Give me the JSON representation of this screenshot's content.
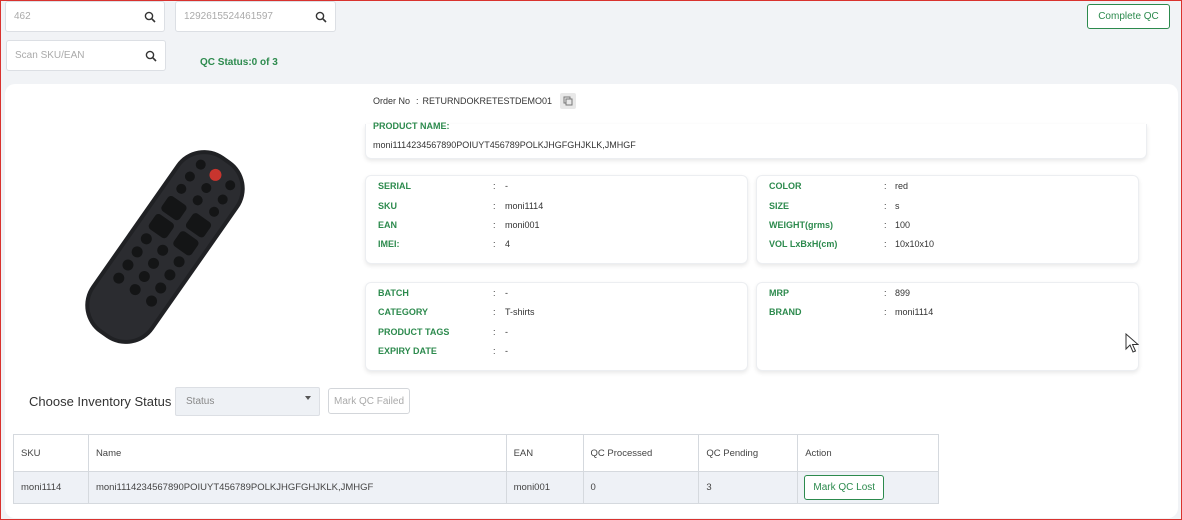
{
  "search": {
    "field1_value": "462",
    "field2_value": "1292615524461597",
    "scan_placeholder": "Scan SKU/EAN"
  },
  "toolbar": {
    "complete_qc_label": "Complete QC",
    "qc_status": "QC Status:0 of 3"
  },
  "order": {
    "label": "Order No",
    "sep": ":",
    "value": "RETURNDOKRETESTDEMO01"
  },
  "product": {
    "name_label": "PRODUCT NAME:",
    "name_value": "moni1114234567890POIUYT456789POLKJHGFGHJKLK,JMHGF"
  },
  "details": {
    "card1": [
      {
        "k": "SERIAL",
        "v": "-"
      },
      {
        "k": "SKU",
        "v": "moni1114"
      },
      {
        "k": "EAN",
        "v": "moni001"
      },
      {
        "k": "IMEI:",
        "v": "4"
      }
    ],
    "card2": [
      {
        "k": "COLOR",
        "v": "red"
      },
      {
        "k": "SIZE",
        "v": "s"
      },
      {
        "k": "WEIGHT(grms)",
        "v": "100"
      },
      {
        "k": "VOL LxBxH(cm)",
        "v": "10x10x10"
      }
    ],
    "card3": [
      {
        "k": "BATCH",
        "v": "-"
      },
      {
        "k": "CATEGORY",
        "v": "T-shirts"
      },
      {
        "k": "PRODUCT TAGS",
        "v": "-"
      },
      {
        "k": "EXPIRY DATE",
        "v": "-"
      }
    ],
    "card4": [
      {
        "k": "MRP",
        "v": "899"
      },
      {
        "k": "BRAND",
        "v": "moni1114"
      }
    ],
    "sep": ":"
  },
  "inventory": {
    "label": "Choose Inventory Status",
    "status_placeholder": "Status",
    "mark_failed_label": "Mark QC Failed"
  },
  "table": {
    "headers": [
      "SKU",
      "Name",
      "EAN",
      "QC Processed",
      "QC Pending",
      "Action"
    ],
    "rows": [
      {
        "sku": "moni1114",
        "name": "moni1114234567890POIUYT456789POLKJHGFGHJKLK,JMHGF",
        "ean": "moni001",
        "processed": "0",
        "pending": "3",
        "action": "Mark QC Lost"
      }
    ]
  },
  "colors": {
    "accent": "#2c8a4d",
    "frame": "#d9322e"
  }
}
